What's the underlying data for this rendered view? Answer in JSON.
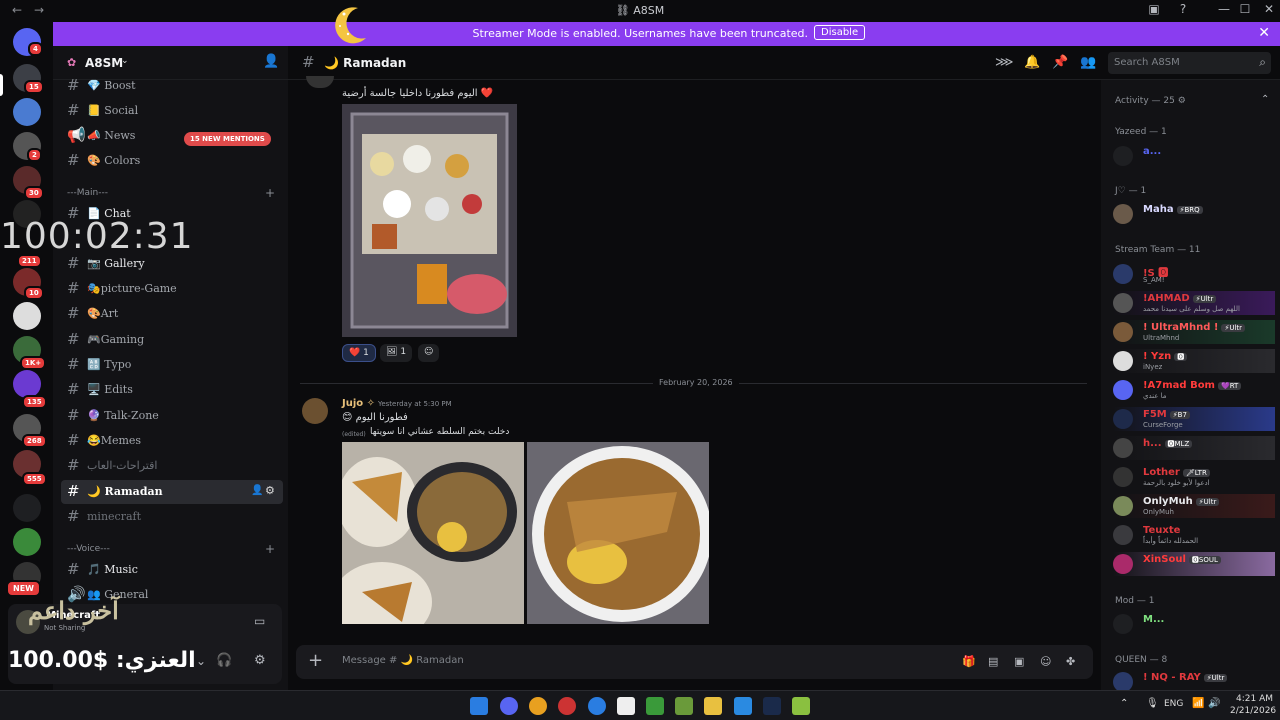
{
  "window": {
    "title": "A8SM"
  },
  "banner": {
    "text": "Streamer Mode is enabled. Usernames have been truncated.",
    "button": "Disable"
  },
  "server": {
    "name": "A8SM",
    "mentions_badge": "15 NEW MENTIONS",
    "channels_top": [
      "💎 Boost",
      "📒 Social",
      "📣 News",
      "🎨 Colors"
    ],
    "category_main": "---Main---",
    "channels_main": [
      "📄 Chat",
      "📷 Gallery",
      "🎭picture-Game",
      "🎨Art",
      "🎮Gaming",
      "🔠 Typo",
      "🖥️ Edits",
      "🔮 Talk-Zone",
      "😂Memes",
      "اقتراحات-العاب",
      "🌙 Ramadan",
      "minecraft"
    ],
    "category_voice": "---Voice---",
    "channels_voice": [
      "🎵 Music",
      "👥 General"
    ]
  },
  "rail_badges": [
    "4",
    "15",
    "2",
    "30",
    "211",
    "10",
    "1K+",
    "135",
    "268",
    "555",
    "NEW"
  ],
  "overlays": {
    "timer": "100:02:31",
    "overlay_top": "آخر داعم",
    "overlay_bottom": "100.00$ :العنزي"
  },
  "user_panel": {
    "name": "Minecraft",
    "status": "Not Sharing"
  },
  "channel": {
    "title": "🌙 Ramadan",
    "search_placeholder": "Search A8SM"
  },
  "messages": [
    {
      "text": "اليوم فطورنا داخليا جالسة أرضية ❤️",
      "reactions": [
        {
          "emoji": "❤️",
          "count": "1"
        },
        {
          "emoji": "🖼",
          "count": "1"
        }
      ]
    },
    {
      "author": "Jujo ✧",
      "time": "Yesterday at 5:30 PM",
      "line1": "😊 فطورنا اليوم",
      "line2": "دخلت بختم السلطه عشاني انا سويتها",
      "edited": "(edited)"
    }
  ],
  "date_separator": "February 20, 2026",
  "composer": {
    "placeholder": "Message # 🌙 Ramadan"
  },
  "members": {
    "activity": "Activity — 25 ⚙",
    "groups": [
      {
        "header": "Yazeed — 1",
        "members": [
          {
            "name": "a...",
            "sub": "",
            "color": "#5865f2"
          }
        ]
      },
      {
        "header": "J♡ — 1",
        "members": [
          {
            "name": "Maha",
            "tag": "⚡BRQ",
            "sub": "",
            "color": "#d9d9ff"
          }
        ]
      },
      {
        "header": "Stream Team — 11",
        "members": [
          {
            "name": "!S 🅾",
            "sub": "S_AM!",
            "color": "#e0393e"
          },
          {
            "name": "!AHMAD",
            "tag": "⚡Ultr",
            "sub": "اللهم صل وسلم على سيدنا محمد",
            "color": "#e0393e"
          },
          {
            "name": "! UltraMhnd !",
            "tag": "⚡Ultr",
            "sub": "UltraMhnd",
            "color": "#ff5a5a"
          },
          {
            "name": "! Yzn",
            "tag": "🅾",
            "sub": "iNyez",
            "color": "#ff3b3b"
          },
          {
            "name": "!A7mad Bom",
            "tag": "💜RT",
            "sub": "ما عندي",
            "color": "#ff3b3b"
          },
          {
            "name": "F5M",
            "tag": "⚡B7",
            "sub": "CurseForge",
            "color": "#e0393e"
          },
          {
            "name": "h...",
            "tag": "🅾MLZ",
            "sub": "",
            "color": "#e0393e"
          },
          {
            "name": "Lother",
            "tag": "🗡LTR",
            "sub": "ادعوا لأبو خلود بالرحمة",
            "color": "#e0393e"
          },
          {
            "name": "OnlyMuh",
            "tag": "⚡Ultr",
            "sub": "OnlyMuh",
            "color": "#e8e9ec"
          },
          {
            "name": "Teuxte",
            "sub": "الحمدلله دائماً وأبداً",
            "color": "#e0393e"
          },
          {
            "name": "XinSoul",
            "tag": "🅾SOUL",
            "sub": "",
            "color": "#ff3b3b"
          }
        ]
      },
      {
        "header": "Mod — 1",
        "members": [
          {
            "name": "M...",
            "sub": "",
            "color": "#7fe07f"
          }
        ]
      },
      {
        "header": "QUEEN — 8",
        "members": [
          {
            "name": "! NQ - RAY",
            "tag": "⚡Ultr",
            "sub": "",
            "color": "#e0393e"
          }
        ]
      }
    ]
  },
  "taskbar": {
    "lang": "ENG",
    "time": "4:21 AM",
    "date": "2/21/2026"
  }
}
